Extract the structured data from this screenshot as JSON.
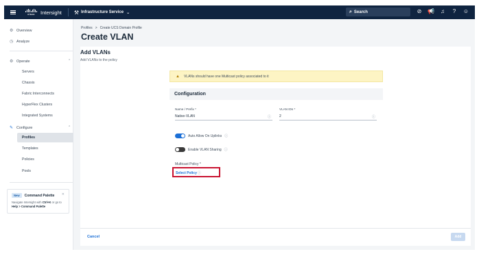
{
  "topbar": {
    "logo_text": "cisco",
    "app_name": "Intersight",
    "service": "Infrastructure Service",
    "search_placeholder": "Search",
    "icons": [
      "check-circle-icon",
      "megaphone-icon",
      "bell-icon",
      "help-icon",
      "user-icon"
    ]
  },
  "sidebar": {
    "overview": "Overview",
    "analyze": "Analyze",
    "operate": "Operate",
    "operate_items": [
      "Servers",
      "Chassis",
      "Fabric Interconnects",
      "HyperFlex Clusters",
      "Integrated Systems"
    ],
    "configure": "Configure",
    "configure_items": [
      "Profiles",
      "Templates",
      "Policies",
      "Pools"
    ],
    "active_item": "Profiles",
    "command_palette": {
      "badge": "New",
      "title": "Command Palette",
      "text_prefix": "Navigate Intersight with ",
      "shortcut": "Ctrl+K",
      "text_middle": " or go to ",
      "path": "Help > Command Palette"
    }
  },
  "header": {
    "breadcrumb_root": "Profiles",
    "breadcrumb_sep": ">",
    "breadcrumb_current": "Create UCS Domain Profile",
    "title": "Create VLAN"
  },
  "form": {
    "section_title": "Add VLANs",
    "section_subtitle": "Add VLANs to the policy",
    "warning": "VLANs should have one Multicast policy associated to it",
    "config_title": "Configuration",
    "name_label": "Name / Prefix *",
    "name_value": "Native-VLAN",
    "vlan_ids_label": "VLAN IDs *",
    "vlan_ids_value": "2",
    "auto_allow_label": "Auto Allow On Uplinks",
    "auto_allow_on": true,
    "vlan_sharing_label": "Enable VLAN Sharing",
    "vlan_sharing_on": false,
    "multicast_label": "Multicast Policy *",
    "select_policy": "Select Policy"
  },
  "footer": {
    "cancel": "Cancel",
    "add": "Add"
  },
  "colors": {
    "topbar": "#0f2440",
    "accent": "#1b6fd6",
    "highlight_box": "#c8102e",
    "warning_bg": "#fdf4c4"
  }
}
